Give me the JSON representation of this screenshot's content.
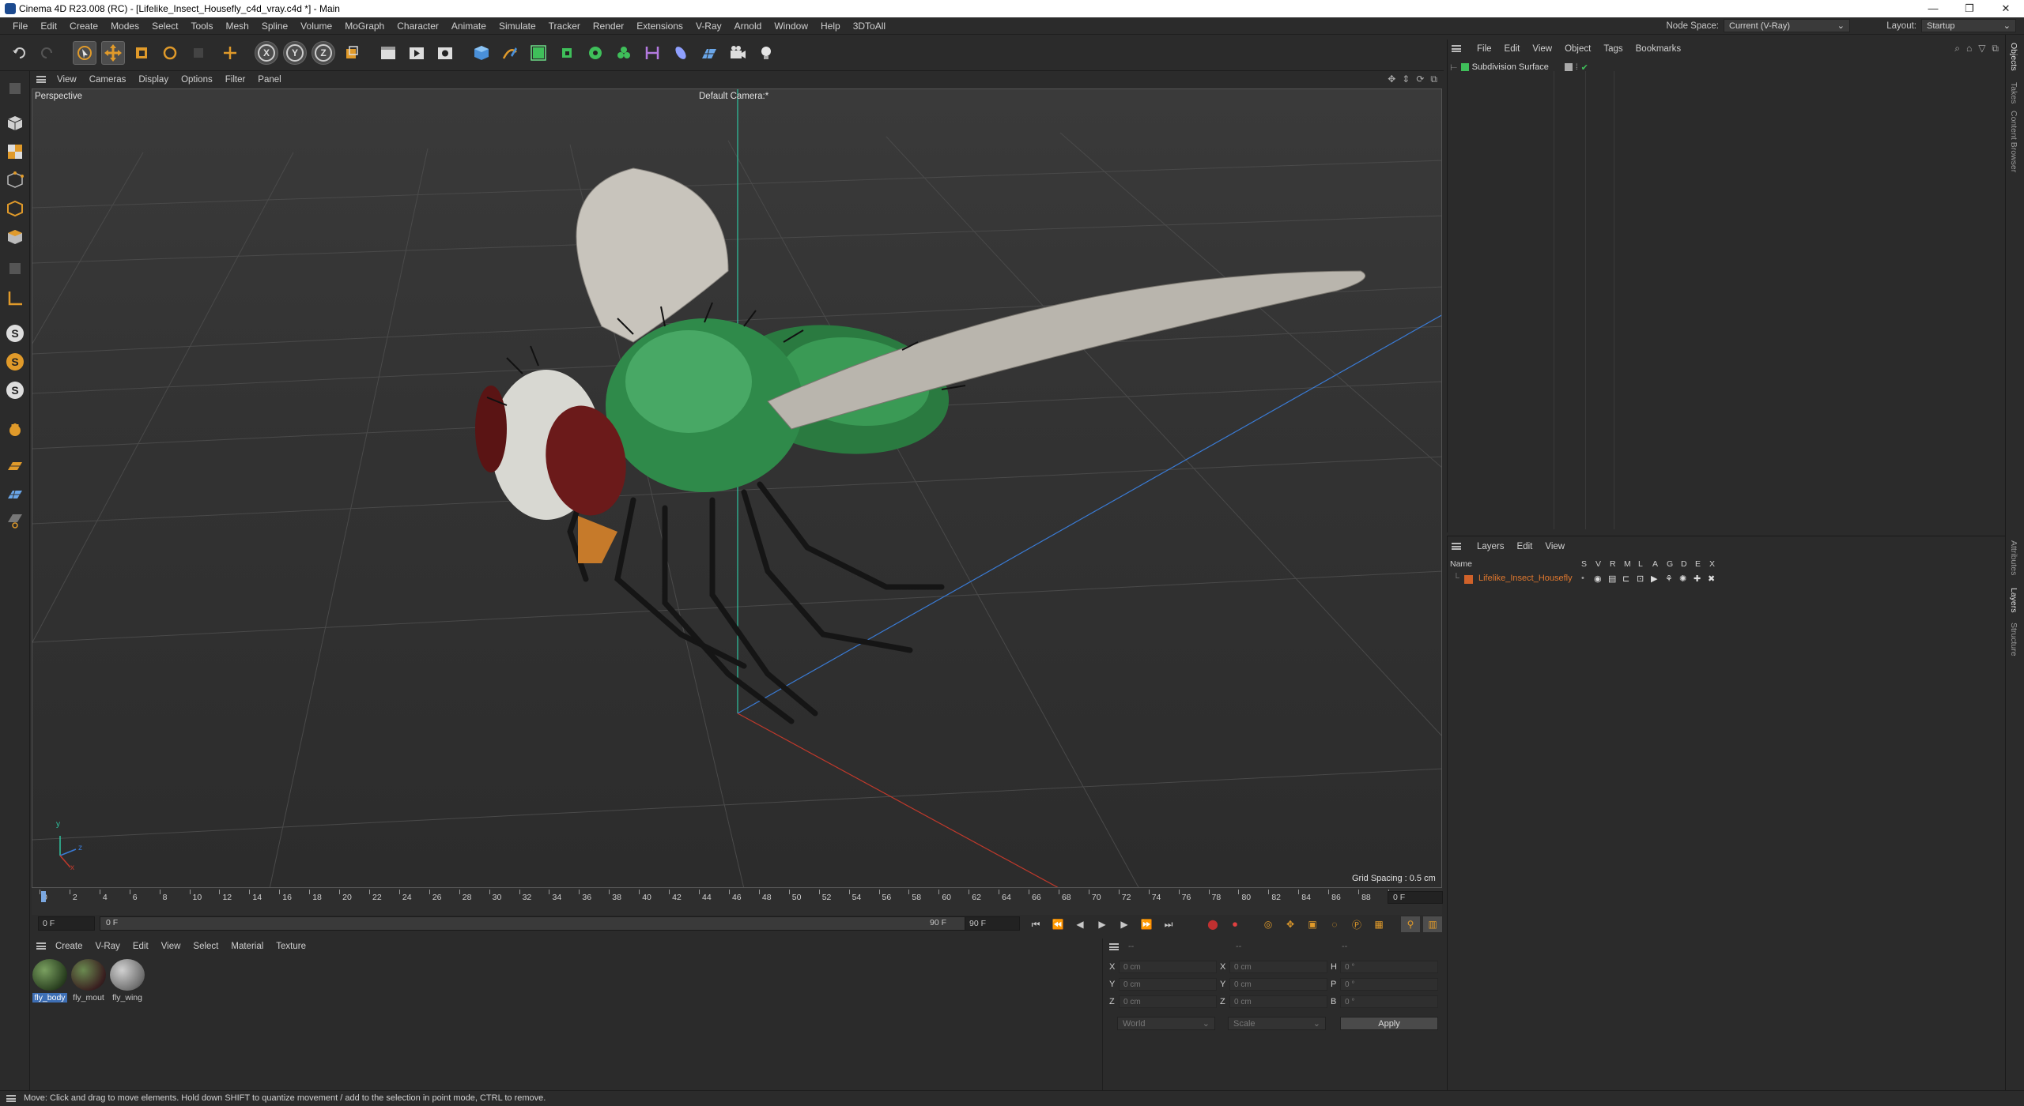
{
  "window": {
    "title": "Cinema 4D R23.008 (RC) - [Lifelike_Insect_Housefly_c4d_vray.c4d *] - Main",
    "controls": [
      "—",
      "❐",
      "✕"
    ]
  },
  "menubar": {
    "items": [
      "File",
      "Edit",
      "Create",
      "Modes",
      "Select",
      "Tools",
      "Mesh",
      "Spline",
      "Volume",
      "MoGraph",
      "Character",
      "Animate",
      "Simulate",
      "Tracker",
      "Render",
      "Extensions",
      "V-Ray",
      "Arnold",
      "Window",
      "Help",
      "3DToAll"
    ],
    "node_space_label": "Node Space:",
    "node_space_value": "Current (V-Ray)",
    "layout_label": "Layout:",
    "layout_value": "Startup"
  },
  "toolbar": {
    "axis_x": "X",
    "axis_y": "Y",
    "axis_z": "Z"
  },
  "leftstrip": {
    "s_labels": [
      "S",
      "S",
      "S"
    ]
  },
  "viewport": {
    "menu": [
      "View",
      "Cameras",
      "Display",
      "Options",
      "Filter",
      "Panel"
    ],
    "label": "Perspective",
    "camera": "Default Camera",
    "camera_mark": ":*",
    "grid_spacing": "Grid Spacing : 0.5 cm",
    "axis_y": "y",
    "axis_z": "z",
    "axis_x": "x"
  },
  "timeline": {
    "ticks": [
      "0",
      "2",
      "4",
      "6",
      "8",
      "10",
      "12",
      "14",
      "16",
      "18",
      "20",
      "22",
      "24",
      "26",
      "28",
      "30",
      "32",
      "34",
      "36",
      "38",
      "40",
      "42",
      "44",
      "46",
      "48",
      "50",
      "52",
      "54",
      "56",
      "58",
      "60",
      "62",
      "64",
      "66",
      "68",
      "70",
      "72",
      "74",
      "76",
      "78",
      "80",
      "82",
      "84",
      "86",
      "88",
      "90"
    ],
    "frame_right": "0 F",
    "start_field": "0 F",
    "range_start": "0 F",
    "range_end": "90 F",
    "end_field": "90 F"
  },
  "materials": {
    "menu": [
      "Create",
      "V-Ray",
      "Edit",
      "View",
      "Select",
      "Material",
      "Texture"
    ],
    "items": [
      {
        "label": "fly_body",
        "selected": true
      },
      {
        "label": "fly_mout",
        "selected": false
      },
      {
        "label": "fly_wing",
        "selected": false
      }
    ]
  },
  "coordinates": {
    "header_a": "--",
    "header_b": "--",
    "header_c": "--",
    "rows": [
      {
        "a": "X",
        "av": "0 cm",
        "b": "X",
        "bv": "0 cm",
        "c": "H",
        "cv": "0 °"
      },
      {
        "a": "Y",
        "av": "0 cm",
        "b": "Y",
        "bv": "0 cm",
        "c": "P",
        "cv": "0 °"
      },
      {
        "a": "Z",
        "av": "0 cm",
        "b": "Z",
        "bv": "0 cm",
        "c": "B",
        "cv": "0 °"
      }
    ],
    "space": "World",
    "mode": "Scale",
    "apply": "Apply"
  },
  "status": "Move: Click and drag to move elements. Hold down SHIFT to quantize movement / add to the selection in point mode, CTRL to remove.",
  "object_manager": {
    "menu": [
      "File",
      "Edit",
      "View",
      "Object",
      "Tags",
      "Bookmarks"
    ],
    "object_name": "Subdivision Surface"
  },
  "layers": {
    "menu": [
      "Layers",
      "Edit",
      "View"
    ],
    "col_name": "Name",
    "col_flags": [
      "S",
      "V",
      "R",
      "M",
      "L",
      "A",
      "G",
      "D",
      "E",
      "X"
    ],
    "layer_name": "Lifelike_Insect_Housefly",
    "layer_color": "#d0622a"
  },
  "sidetabs": [
    "Objects",
    "Takes",
    "Content Browser",
    "Attributes",
    "Layers",
    "Structure"
  ],
  "colors": {
    "accent": "#3e6fb5",
    "axis_x": "#c0392b",
    "axis_y": "#2ec4a0",
    "axis_z": "#3a7bd5",
    "fly_green": "#2f8a4a",
    "fly_eye": "#6b1a1a"
  }
}
